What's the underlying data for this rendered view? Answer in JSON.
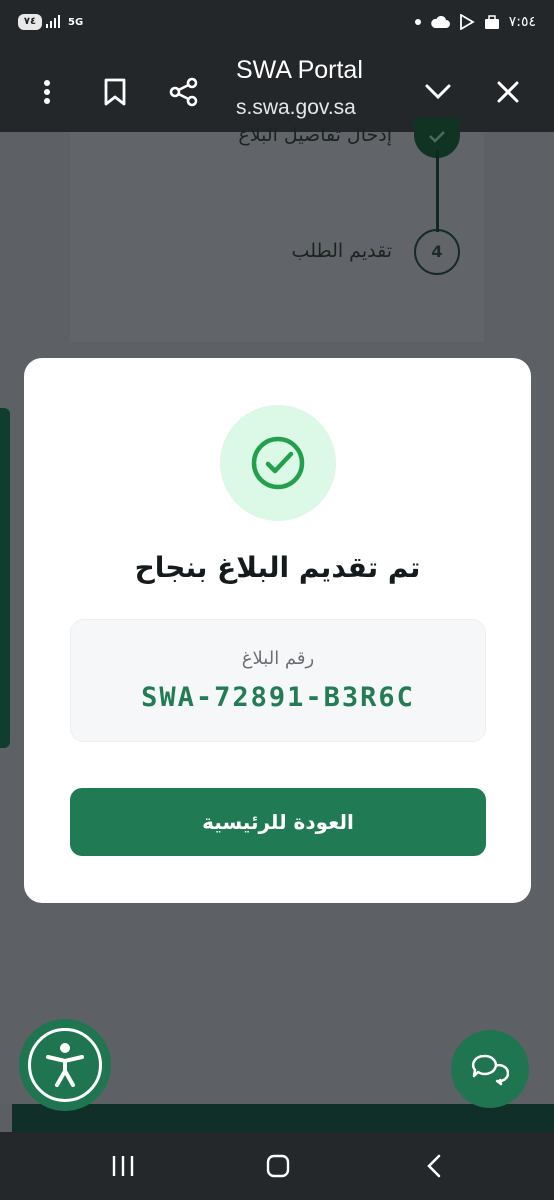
{
  "status_bar": {
    "battery": "٧٤",
    "network": "5G",
    "time": "٧:٥٤"
  },
  "browser_header": {
    "title": "SWA Portal",
    "url": "s.swa.gov.sa",
    "icons": [
      "more-vertical-icon",
      "bookmark-icon",
      "share-icon",
      "chevron-down-icon",
      "close-icon"
    ]
  },
  "page": {
    "steps": [
      {
        "label": "إدخال تفاصيل البلاغ",
        "status": "completed"
      },
      {
        "number": "4",
        "label": "تقديم الطلب",
        "status": "pending"
      }
    ]
  },
  "modal": {
    "title": "تم تقديم البلاغ بنجاح",
    "reference_label": "رقم البلاغ",
    "reference_number": "SWA-72891-B3R6C",
    "home_button": "العودة للرئيسية"
  },
  "colors": {
    "primary": "#207a54",
    "success_bg": "#dcf8e6",
    "success_icon": "#22a04b",
    "header_bg": "#23272a"
  }
}
